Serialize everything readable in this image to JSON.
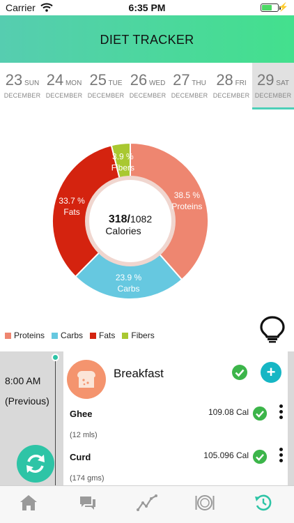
{
  "status_bar": {
    "carrier": "Carrier",
    "time": "6:35 PM"
  },
  "header": {
    "title": "DIET TRACKER"
  },
  "dates": [
    {
      "num": "23",
      "day": "SUN",
      "month": "DECEMBER",
      "selected": false
    },
    {
      "num": "24",
      "day": "MON",
      "month": "DECEMBER",
      "selected": false
    },
    {
      "num": "25",
      "day": "TUE",
      "month": "DECEMBER",
      "selected": false
    },
    {
      "num": "26",
      "day": "WED",
      "month": "DECEMBER",
      "selected": false
    },
    {
      "num": "27",
      "day": "THU",
      "month": "DECEMBER",
      "selected": false
    },
    {
      "num": "28",
      "day": "FRI",
      "month": "DECEMBER",
      "selected": false
    },
    {
      "num": "29",
      "day": "SAT",
      "month": "DECEMBER",
      "selected": true
    }
  ],
  "chart_data": {
    "type": "pie",
    "center": {
      "consumed": "318/",
      "goal": "1082",
      "unit": "Calories"
    },
    "series": [
      {
        "name": "Proteins",
        "value": 38.5,
        "label": "38.5 %",
        "color": "#ee8670"
      },
      {
        "name": "Carbs",
        "value": 23.9,
        "label": "23.9 %",
        "color": "#66c8e0"
      },
      {
        "name": "Fats",
        "value": 33.7,
        "label": "33.7 %",
        "color": "#d4230f"
      },
      {
        "name": "Fibers",
        "value": 3.9,
        "label": "3.9 %",
        "color": "#a9c831"
      }
    ],
    "legend_position": "bottom-left"
  },
  "meal": {
    "time": "8:00 AM",
    "note": "(Previous)",
    "title": "Breakfast",
    "items": [
      {
        "name": "Ghee",
        "qty": "(12 mls)",
        "calories": "109.08 Cal"
      },
      {
        "name": "Curd",
        "qty": "(174 gms)",
        "calories": "105.096 Cal"
      }
    ]
  },
  "icons": {
    "bulb": "lightbulb-icon",
    "sync": "sync-icon",
    "meal": "bread-icon",
    "check": "check-circle-icon",
    "add": "plus-icon",
    "more": "more-vertical-icon"
  },
  "tabs": [
    {
      "name": "home",
      "icon": "home-icon",
      "active": false
    },
    {
      "name": "chat",
      "icon": "chat-icon",
      "active": false
    },
    {
      "name": "progress",
      "icon": "graph-icon",
      "active": false
    },
    {
      "name": "meals",
      "icon": "plate-icon",
      "active": false
    },
    {
      "name": "history",
      "icon": "history-icon",
      "active": true
    }
  ],
  "colors": {
    "accent": "#2ec4a6",
    "header_start": "#56cdb0",
    "header_end": "#43e08d",
    "check": "#3cb54a",
    "add": "#16b6c4",
    "meal_icon_bg": "#f4946e"
  }
}
